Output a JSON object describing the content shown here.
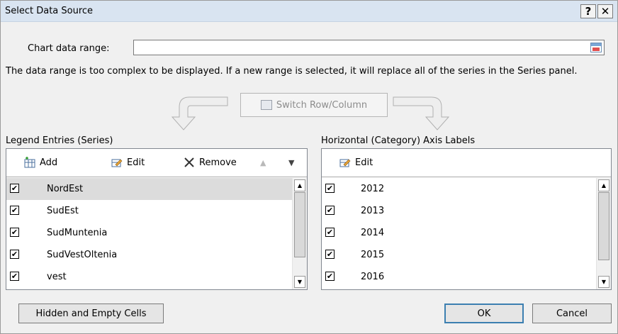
{
  "dialog": {
    "title": "Select Data Source",
    "help": "?",
    "close": "✕"
  },
  "chart_range": {
    "label": "Chart data range:",
    "value": ""
  },
  "info": "The data range is too complex to be displayed. If a new range is selected, it will replace all of the series in the Series panel.",
  "switch_label": "Switch Row/Column",
  "legend": {
    "label": "Legend Entries (Series)",
    "add": "Add",
    "edit": "Edit",
    "remove": "Remove",
    "items": [
      {
        "label": "NordEst",
        "checked": true,
        "selected": true
      },
      {
        "label": "SudEst",
        "checked": true
      },
      {
        "label": "SudMuntenia",
        "checked": true
      },
      {
        "label": "SudVestOltenia",
        "checked": true
      },
      {
        "label": "vest",
        "checked": true
      }
    ]
  },
  "axis": {
    "label": "Horizontal (Category) Axis Labels",
    "edit": "Edit",
    "items": [
      {
        "label": "2012",
        "checked": true
      },
      {
        "label": "2013",
        "checked": true
      },
      {
        "label": "2014",
        "checked": true
      },
      {
        "label": "2015",
        "checked": true
      },
      {
        "label": "2016",
        "checked": true
      }
    ]
  },
  "buttons": {
    "hidden": "Hidden and Empty Cells",
    "ok": "OK",
    "cancel": "Cancel"
  }
}
